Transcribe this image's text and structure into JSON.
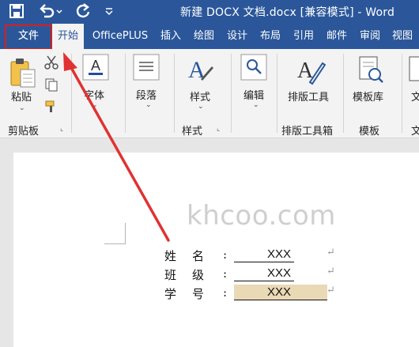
{
  "window": {
    "title": "新建 DOCX 文档.docx [兼容模式]  -  Word"
  },
  "tabs": [
    {
      "label": "文件"
    },
    {
      "label": "开始"
    },
    {
      "label": "OfficePLUS"
    },
    {
      "label": "插入"
    },
    {
      "label": "绘图"
    },
    {
      "label": "设计"
    },
    {
      "label": "布局"
    },
    {
      "label": "引用"
    },
    {
      "label": "邮件"
    },
    {
      "label": "审阅"
    },
    {
      "label": "视图"
    }
  ],
  "ribbon": {
    "paste": "粘贴",
    "clipboard_group": "剪贴板",
    "font": "字体",
    "paragraph": "段落",
    "styles_btn": "样式",
    "styles_group": "样式",
    "edit": "编辑",
    "layout_tool": "排版工具",
    "layout_group": "排版工具箱",
    "template_lib": "模板库",
    "template_group": "模板",
    "cut_off_label": "文"
  },
  "watermark": "khcoo.com",
  "form": [
    {
      "label": "姓名",
      "colon": ":",
      "value": "XXX"
    },
    {
      "label": "班级",
      "colon": ":",
      "value": "XXX"
    },
    {
      "label": "学号",
      "colon": ":",
      "value": "XXX"
    }
  ],
  "return_mark": "↵",
  "colors": {
    "accent": "#2b579a",
    "highlight_box": "#d81e1e",
    "arrow": "#e03232",
    "field_highlight": "#ead9b5"
  }
}
